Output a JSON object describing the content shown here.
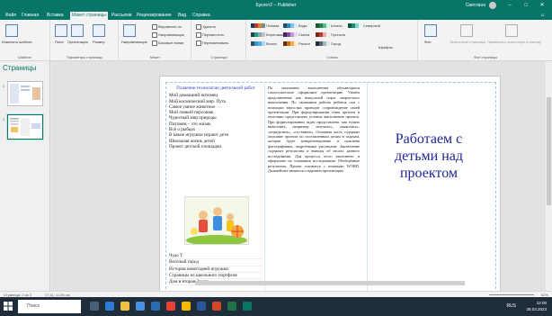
{
  "window": {
    "title": "Буклет2 – Publisher",
    "user": "Светлана",
    "minimize": "–",
    "maximize": "□",
    "close": "✕"
  },
  "tabs": [
    {
      "label": "Файл",
      "active": false
    },
    {
      "label": "Главная",
      "active": false
    },
    {
      "label": "Вставка",
      "active": false
    },
    {
      "label": "Макет страницы",
      "active": true
    },
    {
      "label": "Рассылки",
      "active": false
    },
    {
      "label": "Рецензирование",
      "active": false
    },
    {
      "label": "Вид",
      "active": false
    },
    {
      "label": "Справка",
      "active": false
    }
  ],
  "share_label": "☺",
  "ribbon": {
    "groups": [
      {
        "label": "Шаблон"
      },
      {
        "label": "Параметры страницы"
      },
      {
        "label": "Макет"
      },
      {
        "label": "Страницы"
      },
      {
        "label": "Схемы"
      },
      {
        "label": "Фон страницы"
      }
    ],
    "buttons": {
      "change_template": "Изменить шаблон",
      "margins": "Поля",
      "orientation": "Ориентация",
      "size": "Размер",
      "guides": "Направляющие",
      "align_objects": "Выровнять по",
      "guides_check": "Направляющие",
      "baseline": "Базовые линии",
      "delete": "Удалить",
      "move": "Переместить",
      "rename": "Переименовать",
      "fonts": "Шрифты",
      "background": "Фон",
      "master_pages": "Эталонные страницы",
      "apply_master": "Применить эталонную страницу"
    },
    "schemes": [
      {
        "label": "Плазма",
        "colors": [
          "#1f3a5c",
          "#c0392b",
          "#e67e22",
          "#7f8c8d"
        ]
      },
      {
        "label": "Береговая",
        "colors": [
          "#2c3e50",
          "#16a085",
          "#95a5a6",
          "#bdc3c7"
        ]
      },
      {
        "label": "Волна",
        "colors": [
          "#34495e",
          "#3498db",
          "#5dade2",
          "#aed6f1"
        ]
      },
      {
        "label": "Вода",
        "colors": [
          "#1a5276",
          "#2e86c1",
          "#85c1e9",
          "#d6eaf8"
        ]
      },
      {
        "label": "Смена",
        "colors": [
          "#4a235a",
          "#884ea0",
          "#c39bd3",
          "#e8daef"
        ]
      },
      {
        "label": "Раскол",
        "colors": [
          "#6e2c00",
          "#ca6f1e",
          "#f5b041",
          "#fdebd0"
        ]
      },
      {
        "label": "Шпили",
        "colors": [
          "#145a32",
          "#1e8449",
          "#52be80",
          "#d5f5e3"
        ]
      },
      {
        "label": "Пустыня",
        "colors": [
          "#7b241c",
          "#c0392b",
          "#e6b0aa",
          "#f9ebea"
        ]
      },
      {
        "label": "Город",
        "colors": [
          "#212f3d",
          "#566573",
          "#aab7b8",
          "#e5e8e8"
        ]
      },
      {
        "label": "Северный",
        "colors": [
          "#0b5345",
          "#138d75",
          "#76d7c4",
          "#e8f8f5"
        ]
      }
    ]
  },
  "pane": {
    "title": "Страницы",
    "pages": [
      {
        "num": "1"
      },
      {
        "num": "2"
      }
    ]
  },
  "document": {
    "col1": {
      "heading": "Плачение технологии деятельной работ",
      "lines": [
        "Мой домашний питомец",
        "Мой космический мир. Путь",
        "Самое умное животное",
        "Мой ловкий персонаж",
        "Чудесный мир природы",
        "Питомец – это жизнь",
        "Всё о рыбках",
        "В какие игрушки играют дети",
        "Школьная жизнь детей",
        "Проект детской площадки"
      ],
      "bottom_lines": [
        "Чудо Т",
        "Веселый город",
        "История новогодней игрушки",
        "Страницы из школьного портфеля",
        "Дом и вторая Земля"
      ]
    },
    "col2": {
      "text": "По окончании выполнения обучающиеся самостоятельно оформляют презентацию. Узнаём представление как выпускной порог творческого выполнения. По окончании работы ребёнок сам с помощью взрослых проводит сопровождение своей презентации. При формулировании темы проекта в описании представлено условие выполнения проекта. При формулировании задач представлено, как нужно выполнять, например: «изучить», «выяснить», «определить», «составить». Основная часть содержит описание проекта по поставленным целям и задачам, которая будет конкретизирована и пояснена фотографиями, подробными рисунками. Заключение содержит результаты и выводы об итогах данного исследования. Для процесса этого выполнено и оформлено на основании исследования. Обобщённые результаты. Проект готовится с помощью WORD. Дальнейшее является созданием презентации."
    },
    "col3": {
      "text": "Работаем с детьми над проектом"
    }
  },
  "status": {
    "page": "Страница: 2 из 2",
    "position": "17,11, 11,90 см",
    "zoom": "62%"
  },
  "taskbar": {
    "search_placeholder": "Поиск",
    "time": "12:00",
    "date": "28.03.2023",
    "lang": "RUS",
    "icons": [
      {
        "name": "task-view-icon",
        "color": "#4a6078"
      },
      {
        "name": "edge-icon",
        "color": "#2e7bd6"
      },
      {
        "name": "explorer-icon",
        "color": "#f0c040"
      },
      {
        "name": "store-icon",
        "color": "#4a90e2"
      },
      {
        "name": "mail-icon",
        "color": "#2b6cb0"
      },
      {
        "name": "chrome-icon",
        "color": "#e94235"
      },
      {
        "name": "yandex-icon",
        "color": "#f6b900"
      },
      {
        "name": "word-icon",
        "color": "#2b579a"
      },
      {
        "name": "powerpoint-icon",
        "color": "#d24726"
      },
      {
        "name": "excel-icon",
        "color": "#217346"
      },
      {
        "name": "publisher-icon",
        "color": "#077568"
      }
    ]
  }
}
